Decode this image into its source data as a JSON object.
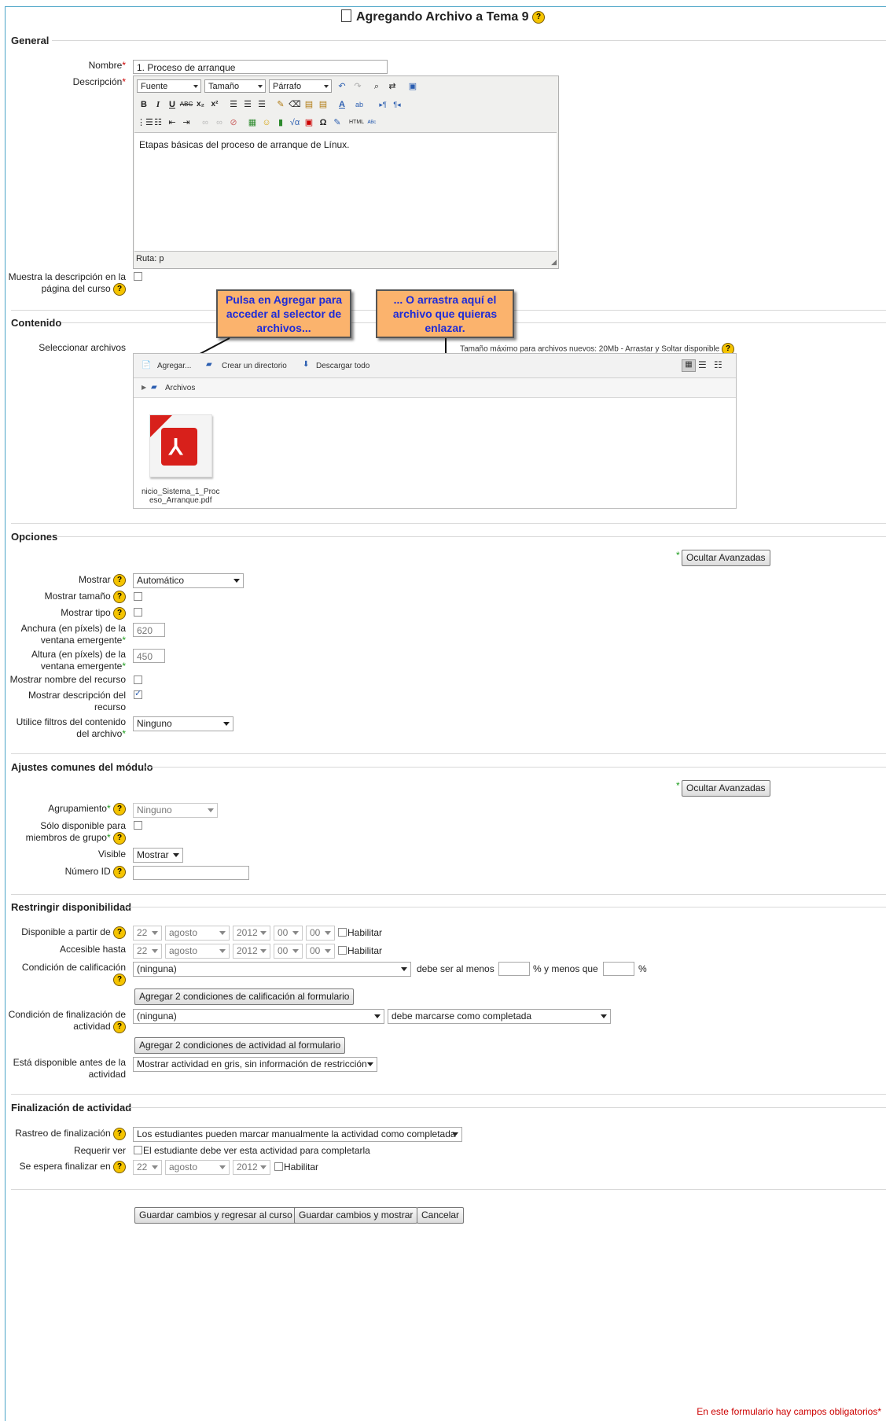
{
  "title": "Agregando Archivo a Tema 9",
  "sections": {
    "general": "General",
    "contenido": "Contenido",
    "opciones": "Opciones",
    "ajustes": "Ajustes comunes del módulo",
    "restringir": "Restringir disponibilidad",
    "finalizacion": "Finalización de actividad"
  },
  "general": {
    "nombre_label": "Nombre",
    "nombre_value": "1. Proceso de arranque",
    "descripcion_label": "Descripción",
    "editor": {
      "font_select": "Fuente",
      "size_select": "Tamaño",
      "format_select": "Párrafo",
      "content": "Etapas básicas del proceso de arranque de Línux.",
      "path": "Ruta: p"
    },
    "muestra_label": "Muestra la descripción en la página del curso"
  },
  "callouts": {
    "left": "Pulsa en Agregar para acceder al selector de archivos...",
    "right": "... O arrastra aquí el archivo que quieras enlazar."
  },
  "contenido": {
    "label": "Seleccionar archivos",
    "max_info": "Tamaño máximo para archivos nuevos: 20Mb - Arrastar y Soltar disponible",
    "agregar": "Agregar...",
    "crear_directorio": "Crear un directorio",
    "descargar": "Descargar todo",
    "folder": "Archivos",
    "file_name_1": "nicio_Sistema_1_Proc",
    "file_name_2": "eso_Arranque.pdf"
  },
  "opciones": {
    "ocultar": "Ocultar Avanzadas",
    "mostrar_label": "Mostrar",
    "mostrar_value": "Automático",
    "tamano_label": "Mostrar tamaño",
    "tipo_label": "Mostrar tipo",
    "anchura_label": "Anchura (en píxels) de la ventana emergente",
    "anchura_value": "620",
    "altura_label": "Altura (en píxels) de la ventana emergente",
    "altura_value": "450",
    "nombre_label": "Mostrar nombre del recurso",
    "descripcion_label": "Mostrar descripción del recurso",
    "filtros_label": "Utilice filtros del contenido del archivo",
    "filtros_value": "Ninguno"
  },
  "ajustes": {
    "ocultar": "Ocultar Avanzadas",
    "agrupamiento_label": "Agrupamiento",
    "agrupamiento_value": "Ninguno",
    "solo_label": "Sólo disponible para miembros de grupo",
    "visible_label": "Visible",
    "visible_value": "Mostrar",
    "numero_label": "Número ID"
  },
  "restringir": {
    "desde_label": "Disponible a partir de",
    "hasta_label": "Accesible hasta",
    "day": "22",
    "month": "agosto",
    "year": "2012",
    "hour": "00",
    "minute": "00",
    "habilitar": "Habilitar",
    "calif_label": "Condición de calificación",
    "calif_value": "(ninguna)",
    "debe_ser": "debe ser al menos",
    "y_menos": "% y menos que",
    "percent": "%",
    "agregar_calif": "Agregar 2 condiciones de calificación al formulario",
    "fin_label": "Condición de finalización de actividad",
    "fin_value": "(ninguna)",
    "fin_cond": "debe marcarse como completada",
    "agregar_act": "Agregar 2 condiciones de actividad al formulario",
    "antes_label": "Está disponible antes de la actividad",
    "antes_value": "Mostrar actividad en gris, sin información de restricción"
  },
  "finalizacion": {
    "rastreo_label": "Rastreo de finalización",
    "rastreo_value": "Los estudiantes pueden marcar manualmente la actividad como completada",
    "requerir_label": "Requerir ver",
    "requerir_text": "El estudiante debe ver esta actividad para completarla",
    "espera_label": "Se espera finalizar en"
  },
  "buttons": {
    "guardar_regresar": "Guardar cambios y regresar al curso",
    "guardar_mostrar": "Guardar cambios y mostrar",
    "cancelar": "Cancelar"
  },
  "footnote": "En este formulario hay campos obligatorios",
  "help_glyph": "?",
  "required_mark": "*",
  "colors": {
    "callout_bg": "#fbb36d",
    "callout_text": "#1d2bd9",
    "required": "#cc0000",
    "frame": "#4aa3c6"
  }
}
